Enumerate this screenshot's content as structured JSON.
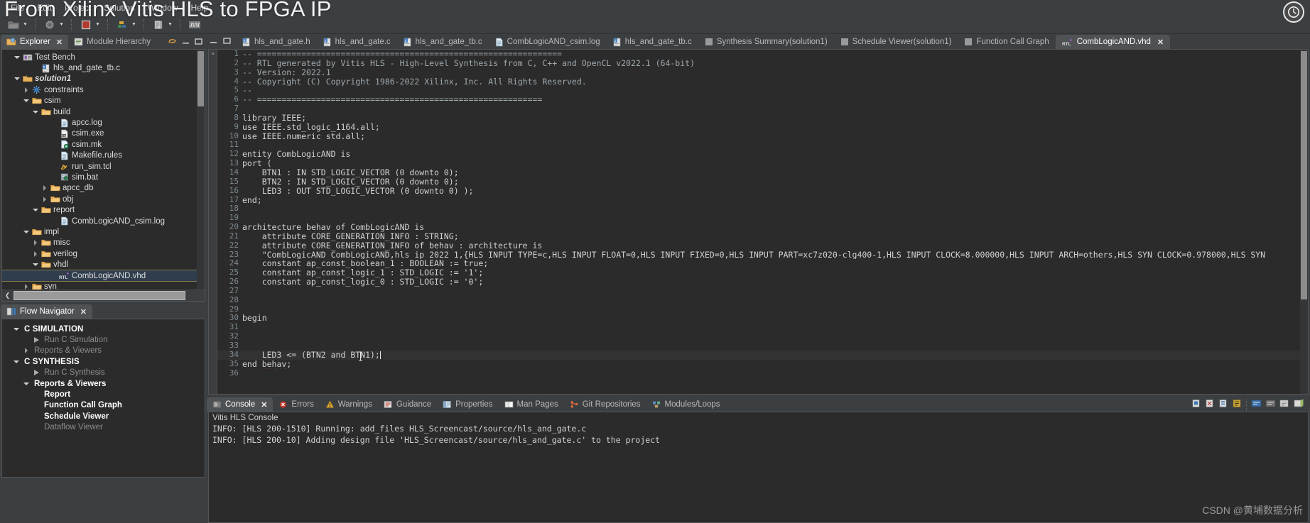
{
  "overlay": {
    "title": "From Xilinx Vitis HLS to FPGA IP",
    "watermark": "CSDN @黄埔数据分析",
    "clock_icon": "clock-icon"
  },
  "menubar": {
    "items": [
      {
        "label": "File"
      },
      {
        "label": "Edit"
      },
      {
        "label": "Project"
      },
      {
        "label": "Solution"
      },
      {
        "label": "Window"
      },
      {
        "label": "Help"
      }
    ]
  },
  "toolbar": {
    "items": [
      {
        "name": "open-folder-icon",
        "has_dropdown": true
      },
      {
        "name": "ip-catalog-icon",
        "has_dropdown": true
      },
      {
        "name": "stop-icon",
        "has_dropdown": true
      },
      {
        "name": "debug-icon",
        "has_dropdown": true
      },
      {
        "name": "report-icon",
        "has_dropdown": true
      },
      {
        "name": "waveform-icon",
        "has_dropdown": false
      }
    ]
  },
  "left_panel": {
    "view_tabs": [
      {
        "label": "Explorer",
        "icon": "explorer-folder-icon",
        "active": true,
        "closable": true
      },
      {
        "label": "Module Hierarchy",
        "icon": "module-hierarchy-icon",
        "active": false,
        "closable": false
      }
    ],
    "tab_tools": [
      {
        "name": "link-with-editor-icon"
      },
      {
        "name": "minimize-icon"
      },
      {
        "name": "maximize-icon"
      }
    ],
    "tree": [
      {
        "label": "Test Bench",
        "indent": 1,
        "twisty": "down",
        "icon": "testbench-icon",
        "style": "normal"
      },
      {
        "label": "hls_and_gate_tb.c",
        "indent": 3,
        "twisty": "none",
        "icon": "c-file-icon",
        "style": "normal"
      },
      {
        "label": "solution1",
        "indent": 1,
        "twisty": "down",
        "icon": "solution-folder-icon",
        "style": "bolditalic"
      },
      {
        "label": "constraints",
        "indent": 2,
        "twisty": "right",
        "icon": "constraints-icon",
        "style": "normal"
      },
      {
        "label": "csim",
        "indent": 2,
        "twisty": "down",
        "icon": "folder-icon",
        "style": "normal"
      },
      {
        "label": "build",
        "indent": 3,
        "twisty": "down",
        "icon": "folder-icon",
        "style": "normal"
      },
      {
        "label": "apcc.log",
        "indent": 5,
        "twisty": "none",
        "icon": "log-file-icon",
        "style": "normal"
      },
      {
        "label": "csim.exe",
        "indent": 5,
        "twisty": "none",
        "icon": "exe-file-icon",
        "style": "normal"
      },
      {
        "label": "csim.mk",
        "indent": 5,
        "twisty": "none",
        "icon": "mk-file-icon",
        "style": "normal"
      },
      {
        "label": "Makefile.rules",
        "indent": 5,
        "twisty": "none",
        "icon": "rules-file-icon",
        "style": "normal"
      },
      {
        "label": "run_sim.tcl",
        "indent": 5,
        "twisty": "none",
        "icon": "tcl-file-icon",
        "style": "normal"
      },
      {
        "label": "sim.bat",
        "indent": 5,
        "twisty": "none",
        "icon": "bat-file-icon",
        "style": "normal"
      },
      {
        "label": "apcc_db",
        "indent": 4,
        "twisty": "right",
        "icon": "folder-icon",
        "style": "normal"
      },
      {
        "label": "obj",
        "indent": 4,
        "twisty": "right",
        "icon": "folder-icon",
        "style": "normal"
      },
      {
        "label": "report",
        "indent": 3,
        "twisty": "down",
        "icon": "folder-icon",
        "style": "normal"
      },
      {
        "label": "CombLogicAND_csim.log",
        "indent": 5,
        "twisty": "none",
        "icon": "log-file-icon",
        "style": "normal"
      },
      {
        "label": "impl",
        "indent": 2,
        "twisty": "down",
        "icon": "folder-icon",
        "style": "normal"
      },
      {
        "label": "misc",
        "indent": 3,
        "twisty": "right",
        "icon": "folder-icon",
        "style": "normal"
      },
      {
        "label": "verilog",
        "indent": 3,
        "twisty": "right",
        "icon": "folder-icon",
        "style": "normal"
      },
      {
        "label": "vhdl",
        "indent": 3,
        "twisty": "down",
        "icon": "folder-icon",
        "style": "normal"
      },
      {
        "label": "CombLogicAND.vhd",
        "indent": 5,
        "twisty": "none",
        "icon": "rtl-file-icon",
        "style": "normal",
        "selected": true
      },
      {
        "label": "syn",
        "indent": 2,
        "twisty": "right",
        "icon": "folder-icon",
        "style": "normal"
      }
    ]
  },
  "flow_navigator": {
    "tabs": [
      {
        "label": "Flow Navigator",
        "icon": "flow-navigator-icon",
        "active": true,
        "closable": true
      }
    ],
    "items": [
      {
        "label": "C SIMULATION",
        "indent": 0,
        "twisty": "down",
        "icon": "none",
        "style": "head"
      },
      {
        "label": "Run C Simulation",
        "indent": 1,
        "twisty": "none",
        "icon": "play-icon",
        "style": "dim"
      },
      {
        "label": "Reports & Viewers",
        "indent": 1,
        "twisty": "right",
        "icon": "none",
        "style": "dim"
      },
      {
        "label": "C SYNTHESIS",
        "indent": 0,
        "twisty": "down",
        "icon": "none",
        "style": "head"
      },
      {
        "label": "Run C Synthesis",
        "indent": 1,
        "twisty": "none",
        "icon": "play-icon",
        "style": "dim"
      },
      {
        "label": "Reports & Viewers",
        "indent": 1,
        "twisty": "down",
        "icon": "none",
        "style": "bold"
      },
      {
        "label": "Report",
        "indent": 2,
        "twisty": "none",
        "icon": "none",
        "style": "bold"
      },
      {
        "label": "Function Call Graph",
        "indent": 2,
        "twisty": "none",
        "icon": "none",
        "style": "bold"
      },
      {
        "label": "Schedule Viewer",
        "indent": 2,
        "twisty": "none",
        "icon": "none",
        "style": "bold"
      },
      {
        "label": "Dataflow Viewer",
        "indent": 2,
        "twisty": "none",
        "icon": "none",
        "style": "dim"
      }
    ]
  },
  "editor": {
    "left_tools": [
      {
        "name": "minimize-icon"
      },
      {
        "name": "maximize-icon"
      }
    ],
    "tabs": [
      {
        "label": "hls_and_gate.h",
        "icon": "h-file-icon",
        "active": false,
        "closable": false
      },
      {
        "label": "hls_and_gate.c",
        "icon": "c-file-icon",
        "active": false,
        "closable": false
      },
      {
        "label": "hls_and_gate_tb.c",
        "icon": "c-file-icon",
        "active": false,
        "closable": false
      },
      {
        "label": "CombLogicAND_csim.log",
        "icon": "log-file-icon",
        "active": false,
        "closable": false
      },
      {
        "label": "hls_and_gate_tb.c",
        "icon": "c-file-icon",
        "active": false,
        "closable": false
      },
      {
        "label": "Synthesis Summary(solution1)",
        "icon": "report-icon",
        "active": false,
        "closable": false
      },
      {
        "label": "Schedule Viewer(solution1)",
        "icon": "schedule-icon",
        "active": false,
        "closable": false
      },
      {
        "label": "Function Call Graph",
        "icon": "callgraph-icon",
        "active": false,
        "closable": false
      },
      {
        "label": "CombLogicAND.vhd",
        "icon": "rtl-file-icon",
        "active": true,
        "closable": true
      }
    ],
    "lines": [
      {
        "n": 1,
        "text": "-- ==============================================================",
        "cls": "c-com"
      },
      {
        "n": 2,
        "text": "-- RTL generated by Vitis HLS - High-Level Synthesis from C, C++ and OpenCL v2022.1 (64-bit)",
        "cls": "c-com"
      },
      {
        "n": 3,
        "text": "-- Version: 2022.1",
        "cls": "c-com"
      },
      {
        "n": 4,
        "text": "-- Copyright (C) Copyright 1986-2022 Xilinx, Inc. All Rights Reserved.",
        "cls": "c-com"
      },
      {
        "n": 5,
        "text": "--",
        "cls": "c-com"
      },
      {
        "n": 6,
        "text": "-- ==========================================================",
        "cls": "c-com"
      },
      {
        "n": 7,
        "text": "",
        "cls": ""
      },
      {
        "n": 8,
        "text": "library IEEE;",
        "cls": ""
      },
      {
        "n": 9,
        "text": "use IEEE.std_logic_1164.all;",
        "cls": ""
      },
      {
        "n": 10,
        "text": "use IEEE.numeric_std.all;",
        "cls": ""
      },
      {
        "n": 11,
        "text": "",
        "cls": ""
      },
      {
        "n": 12,
        "text": "entity CombLogicAND is",
        "cls": ""
      },
      {
        "n": 13,
        "text": "port (",
        "cls": ""
      },
      {
        "n": 14,
        "text": "    BTN1 : IN STD_LOGIC_VECTOR (0 downto 0);",
        "cls": ""
      },
      {
        "n": 15,
        "text": "    BTN2 : IN STD_LOGIC_VECTOR (0 downto 0);",
        "cls": ""
      },
      {
        "n": 16,
        "text": "    LED3 : OUT STD_LOGIC_VECTOR (0 downto 0) );",
        "cls": ""
      },
      {
        "n": 17,
        "text": "end;",
        "cls": ""
      },
      {
        "n": 18,
        "text": "",
        "cls": ""
      },
      {
        "n": 19,
        "text": "",
        "cls": ""
      },
      {
        "n": 20,
        "text": "architecture behav of CombLogicAND is",
        "cls": ""
      },
      {
        "n": 21,
        "text": "    attribute CORE_GENERATION_INFO : STRING;",
        "cls": ""
      },
      {
        "n": 22,
        "text": "    attribute CORE_GENERATION_INFO of behav : architecture is",
        "cls": ""
      },
      {
        "n": 23,
        "text": "    \"CombLogicAND_CombLogicAND,hls_ip_2022_1,{HLS_INPUT_TYPE=c,HLS_INPUT_FLOAT=0,HLS_INPUT_FIXED=0,HLS_INPUT_PART=xc7z020-clg400-1,HLS_INPUT_CLOCK=8.000000,HLS_INPUT_ARCH=others,HLS_SYN_CLOCK=0.978000,HLS_SYN",
        "cls": ""
      },
      {
        "n": 24,
        "text": "    constant ap_const_boolean_1 : BOOLEAN := true;",
        "cls": ""
      },
      {
        "n": 25,
        "text": "    constant ap_const_logic_1 : STD_LOGIC := '1';",
        "cls": ""
      },
      {
        "n": 26,
        "text": "    constant ap_const_logic_0 : STD_LOGIC := '0';",
        "cls": ""
      },
      {
        "n": 27,
        "text": "",
        "cls": ""
      },
      {
        "n": 28,
        "text": "",
        "cls": ""
      },
      {
        "n": 29,
        "text": "",
        "cls": ""
      },
      {
        "n": 30,
        "text": "begin",
        "cls": ""
      },
      {
        "n": 31,
        "text": "",
        "cls": ""
      },
      {
        "n": 32,
        "text": "",
        "cls": ""
      },
      {
        "n": 33,
        "text": "",
        "cls": ""
      },
      {
        "n": 34,
        "text": "    LED3 <= (BTN2 and BTN1);",
        "cls": "",
        "caret": true,
        "highlight": true
      },
      {
        "n": 35,
        "text": "end behav;",
        "cls": ""
      },
      {
        "n": 36,
        "text": "",
        "cls": ""
      }
    ]
  },
  "console": {
    "tabs": [
      {
        "label": "Console",
        "icon": "console-icon",
        "active": true,
        "closable": true
      },
      {
        "label": "Errors",
        "icon": "error-icon",
        "active": false,
        "closable": false
      },
      {
        "label": "Warnings",
        "icon": "warning-icon",
        "active": false,
        "closable": false
      },
      {
        "label": "Guidance",
        "icon": "guidance-icon",
        "active": false,
        "closable": false
      },
      {
        "label": "Properties",
        "icon": "properties-icon",
        "active": false,
        "closable": false
      },
      {
        "label": "Man Pages",
        "icon": "manpages-icon",
        "active": false,
        "closable": false
      },
      {
        "label": "Git Repositories",
        "icon": "git-icon",
        "active": false,
        "closable": false
      },
      {
        "label": "Modules/Loops",
        "icon": "modules-icon",
        "active": false,
        "closable": false
      }
    ],
    "tools": [
      {
        "name": "terminate-icon"
      },
      {
        "name": "remove-launch-icon"
      },
      {
        "name": "remove-all-icon"
      },
      {
        "name": "clear-console-icon"
      },
      {
        "name": "scroll-lock-icon"
      },
      {
        "name": "pin-console-icon"
      },
      {
        "name": "display-selected-console-icon"
      },
      {
        "name": "open-console-icon"
      }
    ],
    "title": "Vitis HLS Console",
    "lines": [
      "INFO: [HLS 200-1510] Running: add_files HLS_Screencast/source/hls_and_gate.c ",
      "INFO: [HLS 200-10] Adding design file 'HLS_Screencast/source/hls_and_gate.c' to the project"
    ]
  },
  "colors": {
    "window_bg": "#3c3f41",
    "panel_bg": "#2b2b2b",
    "active_tab_bg": "#4e5254",
    "text": "#d6d6d6",
    "line_number": "#7d8b91",
    "comment": "#9fa8ae",
    "selection": "#2f3d4d",
    "folder": "#e8b15c"
  }
}
